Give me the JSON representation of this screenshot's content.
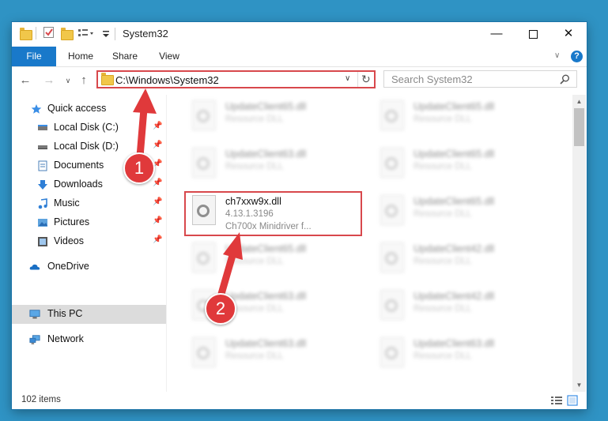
{
  "window": {
    "title": "System32"
  },
  "ribbon": {
    "tabs": [
      "File",
      "Home",
      "Share",
      "View"
    ]
  },
  "address": {
    "path": "C:\\Windows\\System32"
  },
  "search": {
    "placeholder": "Search System32"
  },
  "sidebar": {
    "items": [
      {
        "label": "Quick access",
        "icon": "star-icon"
      },
      {
        "label": "Local Disk (C:)",
        "icon": "drive-icon"
      },
      {
        "label": "Local Disk (D:)",
        "icon": "drive-icon"
      },
      {
        "label": "Documents",
        "icon": "document-icon"
      },
      {
        "label": "Downloads",
        "icon": "download-icon"
      },
      {
        "label": "Music",
        "icon": "music-icon"
      },
      {
        "label": "Pictures",
        "icon": "pictures-icon"
      },
      {
        "label": "Videos",
        "icon": "video-icon"
      },
      {
        "label": "OneDrive",
        "icon": "cloud-icon"
      },
      {
        "label": "This PC",
        "icon": "computer-icon"
      },
      {
        "label": "Network",
        "icon": "network-icon"
      }
    ]
  },
  "files": {
    "highlighted": {
      "name": "ch7xxw9x.dll",
      "version": "4.13.1.3196",
      "description": "Ch700x Minidriver f..."
    },
    "left": [
      {
        "name": "UpdateClient65.dll",
        "type": "Resource DLL"
      },
      {
        "name": "UpdateClient63.dll",
        "type": "Resource DLL"
      },
      {
        "name": "UpdateClient65.dll",
        "type": "Resource DLL"
      },
      {
        "name": "UpdateClient63.dll",
        "type": "Resource DLL"
      },
      {
        "name": "UpdateClient63.dll",
        "type": "Resource DLL"
      }
    ],
    "right": [
      {
        "name": "UpdateClient65.dll",
        "type": "Resource DLL"
      },
      {
        "name": "UpdateClient65.dll",
        "type": "Resource DLL"
      },
      {
        "name": "UpdateClient65.dll",
        "type": "Resource DLL"
      },
      {
        "name": "UpdateClient42.dll",
        "type": "Resource DLL"
      },
      {
        "name": "UpdateClient42.dll",
        "type": "Resource DLL"
      },
      {
        "name": "UpdateClient63.dll",
        "type": "Resource DLL"
      }
    ]
  },
  "status": {
    "count": "102 items"
  },
  "annotations": {
    "step1": "1",
    "step2": "2"
  },
  "colors": {
    "accent": "#1979ca",
    "highlight": "#d8484c",
    "desktop": "#2f93c4"
  }
}
